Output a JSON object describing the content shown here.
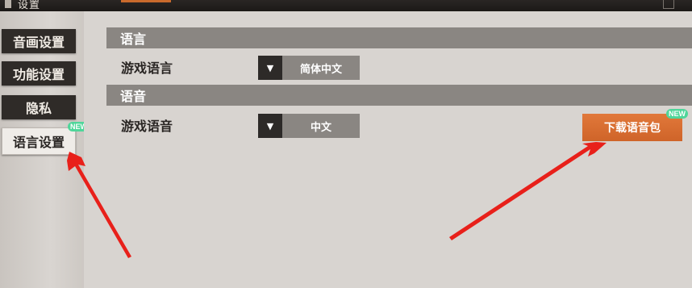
{
  "window": {
    "title": "设置"
  },
  "sidebar": {
    "items": [
      {
        "label": "音画设置"
      },
      {
        "label": "功能设置"
      },
      {
        "label": "隐私"
      },
      {
        "label": "语言设置",
        "active": true,
        "badge": "NEW"
      }
    ]
  },
  "sections": {
    "language": {
      "header": "语言",
      "row_label": "游戏语言",
      "dropdown_value": "简体中文"
    },
    "voice": {
      "header": "语音",
      "row_label": "游戏语音",
      "dropdown_value": "中文",
      "download_label": "下载语音包",
      "download_badge": "NEW"
    }
  },
  "icons": {
    "dropdown_arrow": "▼"
  },
  "colors": {
    "accent": "#d46a2e",
    "badge": "#4fd69a",
    "annotation_arrow": "#e8201a"
  }
}
